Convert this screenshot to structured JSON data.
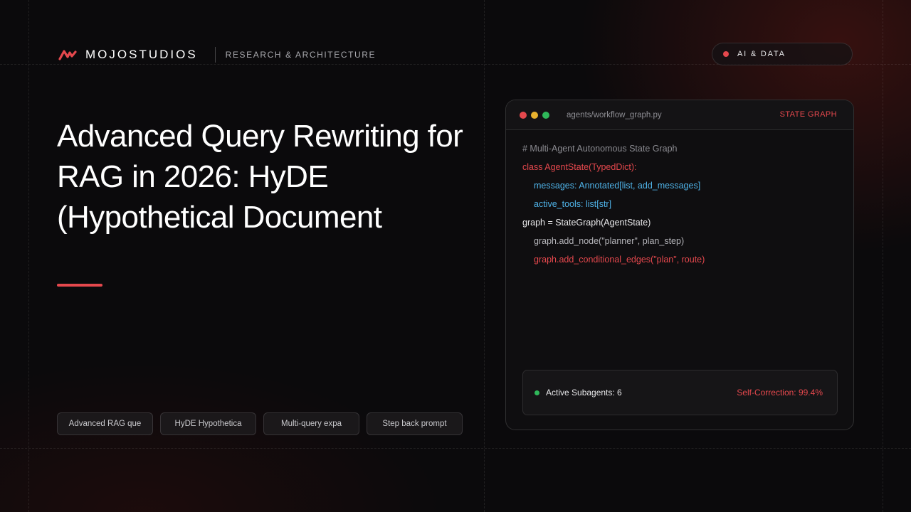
{
  "brand": {
    "name": "MOJOSTUDIOS",
    "tagline": "RESEARCH & ARCHITECTURE",
    "logo_icon": "mojo-wave-logo"
  },
  "badge": {
    "label": "AI & DATA",
    "dot_color": "#e5484d"
  },
  "title": {
    "line1": "Advanced Query Rewriting for",
    "line2": "RAG in 2026: HyDE",
    "line3": "(Hypothetical Document"
  },
  "tags": [
    "Advanced RAG que",
    "HyDE Hypothetica",
    "Multi-query expa",
    "Step back prompt"
  ],
  "code_window": {
    "filename": "agents/workflow_graph.py",
    "tag": "STATE GRAPH",
    "lines": [
      "# Multi-Agent Autonomous State Graph",
      "class AgentState(TypedDict):",
      "messages: Annotated[list, add_messages]",
      "active_tools: list[str]",
      "graph = StateGraph(AgentState)",
      "graph.add_node(\"planner\", plan_step)",
      "graph.add_conditional_edges(\"plan\", route)"
    ],
    "status": {
      "left": "Active Subagents: 6",
      "right": "Self-Correction: 99.4%"
    }
  },
  "colors": {
    "accent": "#e5484d",
    "code_blue": "#4fb3e8",
    "status_green": "#2fb85a",
    "background": "#0b0a0c"
  }
}
